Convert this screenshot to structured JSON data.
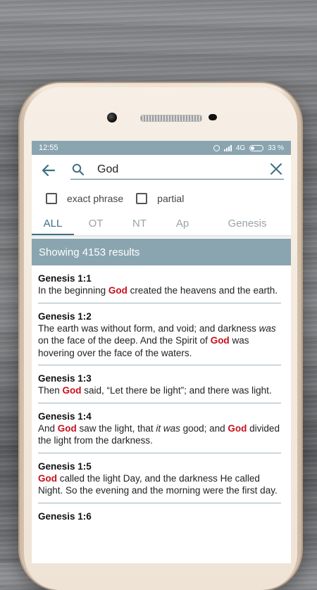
{
  "status_bar": {
    "time": "12:55",
    "network": "4G",
    "battery_percent": "33 %",
    "battery_level": 0.33,
    "icons": [
      "alarm-icon",
      "signal-icon",
      "battery-icon"
    ]
  },
  "search": {
    "query": "God",
    "icons": [
      "back-arrow-icon",
      "search-icon",
      "close-icon"
    ]
  },
  "options": {
    "exact_phrase_label": "exact phrase",
    "exact_phrase_checked": false,
    "partial_label": "partial",
    "partial_checked": false
  },
  "tabs": [
    {
      "label": "ALL",
      "active": true
    },
    {
      "label": "OT",
      "active": false
    },
    {
      "label": "NT",
      "active": false
    },
    {
      "label": "Ap",
      "active": false
    },
    {
      "label": "Genesis",
      "active": false
    }
  ],
  "results_header": "Showing 4153 results",
  "colors": {
    "accent": "#8aa5b0",
    "tab_active": "#3f6f86",
    "highlight": "#c8101a"
  },
  "results": [
    {
      "reference": "Genesis 1:1",
      "segments": [
        {
          "t": "In the beginning "
        },
        {
          "t": "God",
          "hl": true
        },
        {
          "t": " created the heavens and the earth."
        }
      ]
    },
    {
      "reference": "Genesis 1:2",
      "segments": [
        {
          "t": "The earth was without form, and void; and darkness "
        },
        {
          "t": "was",
          "it": true
        },
        {
          "t": " on the face of the deep. And the Spirit of "
        },
        {
          "t": "God",
          "hl": true
        },
        {
          "t": " was hovering over the face of the waters."
        }
      ]
    },
    {
      "reference": "Genesis 1:3",
      "segments": [
        {
          "t": "Then "
        },
        {
          "t": "God",
          "hl": true
        },
        {
          "t": " said, “Let there be light”; and there was light."
        }
      ]
    },
    {
      "reference": "Genesis 1:4",
      "segments": [
        {
          "t": "And "
        },
        {
          "t": "God",
          "hl": true
        },
        {
          "t": " saw the light, that "
        },
        {
          "t": "it was",
          "it": true
        },
        {
          "t": " good; and "
        },
        {
          "t": "God",
          "hl": true
        },
        {
          "t": " divided the light from the darkness."
        }
      ]
    },
    {
      "reference": "Genesis 1:5",
      "segments": [
        {
          "t": "God",
          "hl": true
        },
        {
          "t": " called the light Day, and the darkness He called Night. So the evening and the morning were the first day."
        }
      ]
    },
    {
      "reference": "Genesis 1:6",
      "segments": []
    }
  ]
}
